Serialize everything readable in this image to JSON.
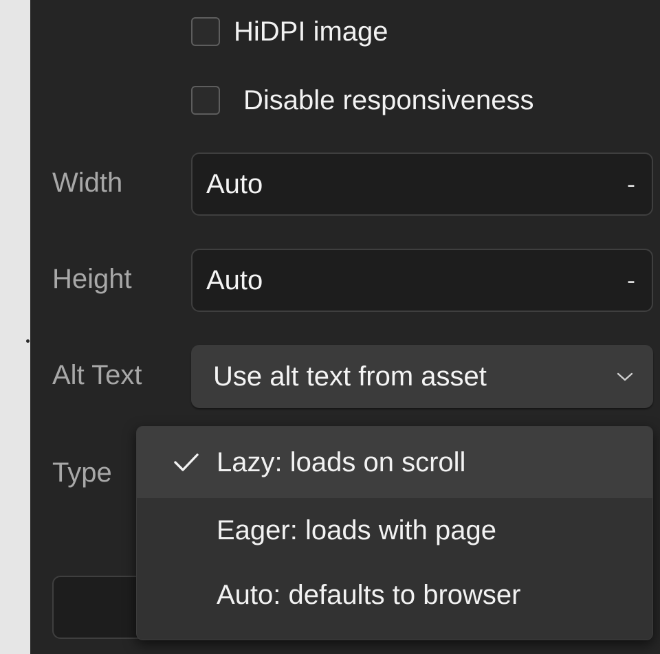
{
  "options": {
    "hidpi_label": "HiDPI image",
    "disable_responsiveness_label": "Disable responsiveness"
  },
  "width": {
    "label": "Width",
    "value": "Auto",
    "unit": "-"
  },
  "height": {
    "label": "Height",
    "value": "Auto",
    "unit": "-"
  },
  "alt_text": {
    "label": "Alt Text",
    "value": "Use alt text from asset"
  },
  "type": {
    "label": "Type",
    "menu": [
      {
        "label": "Lazy: loads on scroll",
        "selected": true
      },
      {
        "label": "Eager: loads with page",
        "selected": false
      },
      {
        "label": "Auto: defaults to browser",
        "selected": false
      }
    ]
  },
  "colors": {
    "panel_bg": "#252525",
    "field_bg": "#1d1d1d",
    "select_bg": "#3b3b3b",
    "menu_bg": "#323232",
    "menu_selected_bg": "#3e3e3e",
    "label_text": "#a8a8a8",
    "value_text": "#f4f4f4"
  },
  "icons": {
    "checkmark": "checkmark-icon",
    "chevron": "chevron-down-icon"
  }
}
